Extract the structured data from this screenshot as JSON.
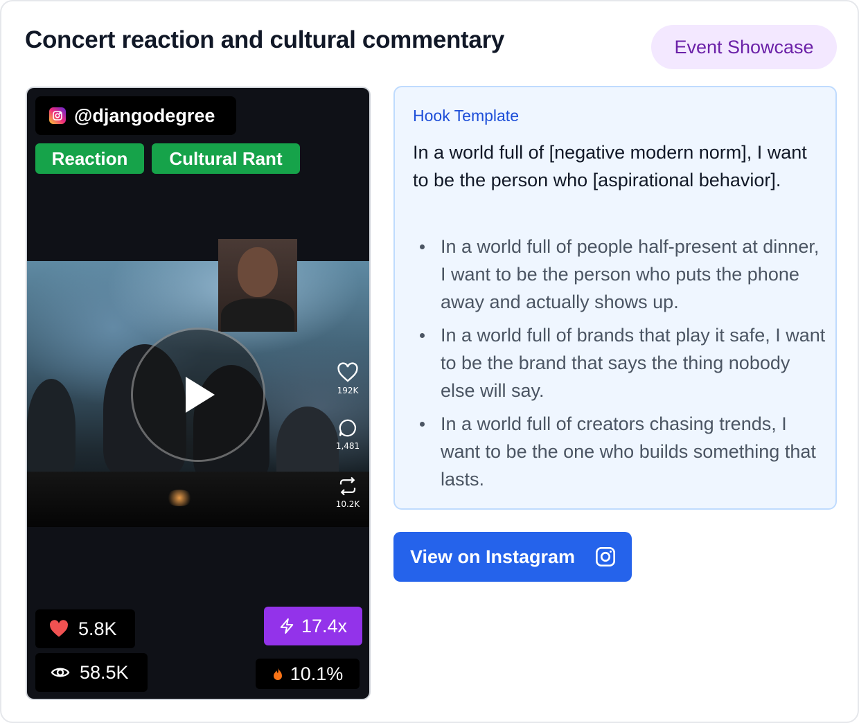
{
  "header": {
    "title": "Concert reaction and cultural commentary",
    "category_badge": "Event Showcase"
  },
  "video": {
    "handle": "@djangodegree",
    "platform_icon": "instagram-icon",
    "tags": [
      "Reaction",
      "Cultural Rant"
    ],
    "side_actions": {
      "likes": "192K",
      "comments": "1,481",
      "shares": "10.2K"
    },
    "stats": {
      "likes": "5.8K",
      "views": "58.5K",
      "multiplier": "17.4x",
      "engagement": "10.1%"
    },
    "colors": {
      "tag": "#16a34a",
      "multiplier": "#9333ea",
      "heart": "#f05252",
      "flame": "#f97316"
    }
  },
  "hook": {
    "label": "Hook Template",
    "template": "In a world full of [negative modern norm], I want to be the person who [aspirational behavior].",
    "examples": [
      "In a world full of people half-present at dinner, I want to be the person who puts the phone away and actually shows up.",
      "In a world full of brands that play it safe, I want to be the brand that says the thing nobody else will say.",
      "In a world full of creators chasing trends, I want to be the one who builds something that lasts."
    ]
  },
  "cta": {
    "label": "View on Instagram",
    "icon": "instagram-icon",
    "color": "#2563eb"
  }
}
